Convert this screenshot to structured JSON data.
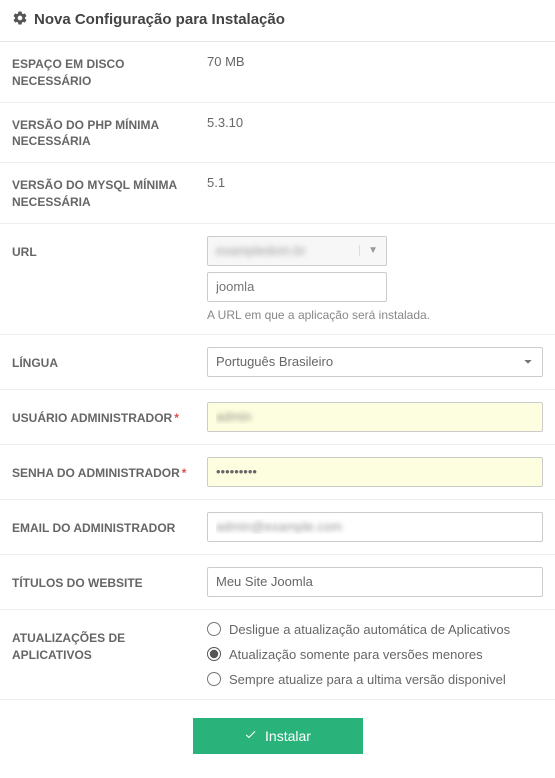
{
  "header": {
    "title": "Nova Configuração para Instalação"
  },
  "rows": {
    "disk_space": {
      "label": "ESPAÇO EM DISCO NECESSÁRIO",
      "value": "70 MB"
    },
    "php_version": {
      "label": "VERSÃO DO PHP MÍNIMA NECESSÁRIA",
      "value": "5.3.10"
    },
    "mysql_version": {
      "label": "VERSÃO DO MYSQL MÍNIMA NECESSÁRIA",
      "value": "5.1"
    },
    "url": {
      "label": "URL",
      "domain_masked": "exampledom.br",
      "path_placeholder": "joomla",
      "hint": "A URL em que a aplicação será instalada."
    },
    "language": {
      "label": "LÍNGUA",
      "selected": "Português Brasileiro"
    },
    "admin_user": {
      "label": "USUÁRIO ADMINISTRADOR",
      "value_masked": "admin"
    },
    "admin_pass": {
      "label": "SENHA DO ADMINISTRADOR",
      "value": "•••••••••"
    },
    "admin_email": {
      "label": "EMAIL DO ADMINISTRADOR",
      "value_masked": "admin@example.com"
    },
    "site_title": {
      "label": "TÍTULOS DO WEBSITE",
      "value": "Meu Site Joomla"
    },
    "updates": {
      "label": "ATUALIZAÇÕES DE APLICATIVOS",
      "options": [
        "Desligue a atualização automática de Aplicativos",
        "Atualização somente para versões menores",
        "Sempre atualize para a ultima versão disponivel"
      ],
      "selected_index": 1
    }
  },
  "button": {
    "install": "Instalar"
  }
}
